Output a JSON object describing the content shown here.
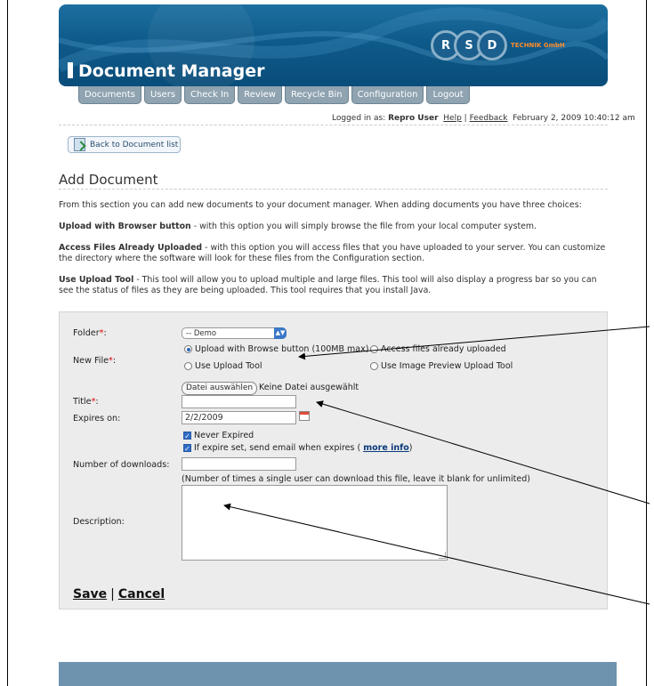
{
  "header": {
    "title": "Document Manager",
    "logo_letters": [
      "R",
      "S",
      "D"
    ],
    "logo_tag": "TECHNIK GmbH"
  },
  "tabs": [
    "Documents",
    "Users",
    "Check In",
    "Review",
    "Recycle Bin",
    "Configuration",
    "Logout"
  ],
  "userbar": {
    "logged_in_prefix": "Logged in as:",
    "user": "Repro User",
    "help": "Help",
    "separator": "|",
    "feedback": "Feedback",
    "datetime": "February 2, 2009 10:40:12 am"
  },
  "back_button": "Back to Document list",
  "page_title": "Add Document",
  "intro": "From this section you can add new documents to your document manager. When adding documents you have three choices:",
  "choices": [
    {
      "label": "Upload with Browser button",
      "text": " - with this option you will simply browse the file from your local computer system."
    },
    {
      "label": "Access Files Already Uploaded",
      "text": " - with this option you will access files that you have uploaded to your server. You can customize the directory where the software will look for these files from the Configuration section."
    },
    {
      "label": "Use Upload Tool",
      "text": " - This tool will allow you to upload multiple and large files. This tool will also display a progress bar so you can see the status of files as they are being uploaded. This tool requires that you install Java."
    }
  ],
  "form": {
    "folder_label": "Folder",
    "folder_value": "-- Demo",
    "new_file_label": "New File",
    "required_mark": "*",
    "colon": ":",
    "options": [
      "Upload with Browse button (100MB max)",
      "Access files already uploaded",
      "Use Upload Tool",
      "Use Image Preview Upload Tool"
    ],
    "selected_option": "Upload with Browse button (100MB max)",
    "file_button": "Datei auswählen",
    "no_file": "Keine Datei ausgewählt",
    "title_label": "Title",
    "title_value": "",
    "expires_label": "Expires on:",
    "expires_value": "2/2/2009",
    "never_expired": "Never Expired",
    "send_email": "If expire set, send email when expires (",
    "more_info": "more info",
    "send_email_end": ")",
    "downloads_label": "Number of downloads:",
    "downloads_value": "",
    "downloads_hint": "(Number of times a single user can download this file, leave it blank for unlimited)",
    "description_label": "Description:",
    "description_value": "",
    "save": "Save",
    "action_sep": "|",
    "cancel": "Cancel"
  }
}
